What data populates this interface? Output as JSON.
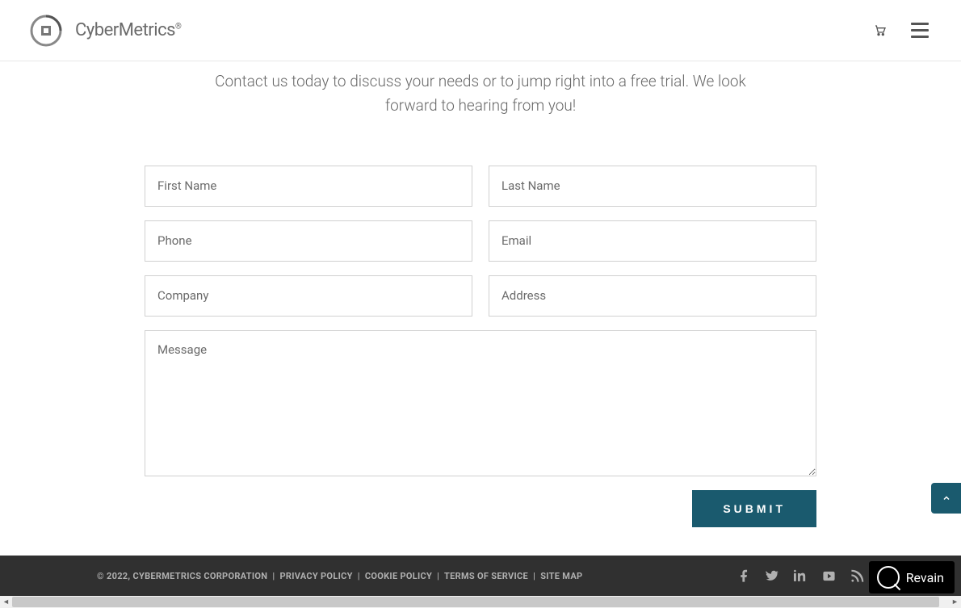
{
  "header": {
    "logo_text": "CyberMetrics",
    "logo_reg": "®"
  },
  "content": {
    "intro": "Contact us today to discuss your needs or to jump right into a free trial. We look forward to hearing from you!"
  },
  "form": {
    "first_name_ph": "First Name",
    "last_name_ph": "Last Name",
    "phone_ph": "Phone",
    "email_ph": "Email",
    "company_ph": "Company",
    "address_ph": "Address",
    "message_ph": "Message",
    "submit_label": "SUBMIT"
  },
  "footer": {
    "copyright": "© 2022, CYBERMETRICS CORPORATION",
    "privacy": "PRIVACY POLICY",
    "cookie": "COOKIE POLICY",
    "terms": "TERMS OF SERVICE",
    "sitemap": "SITE MAP"
  },
  "badge": {
    "label": "Revain"
  }
}
